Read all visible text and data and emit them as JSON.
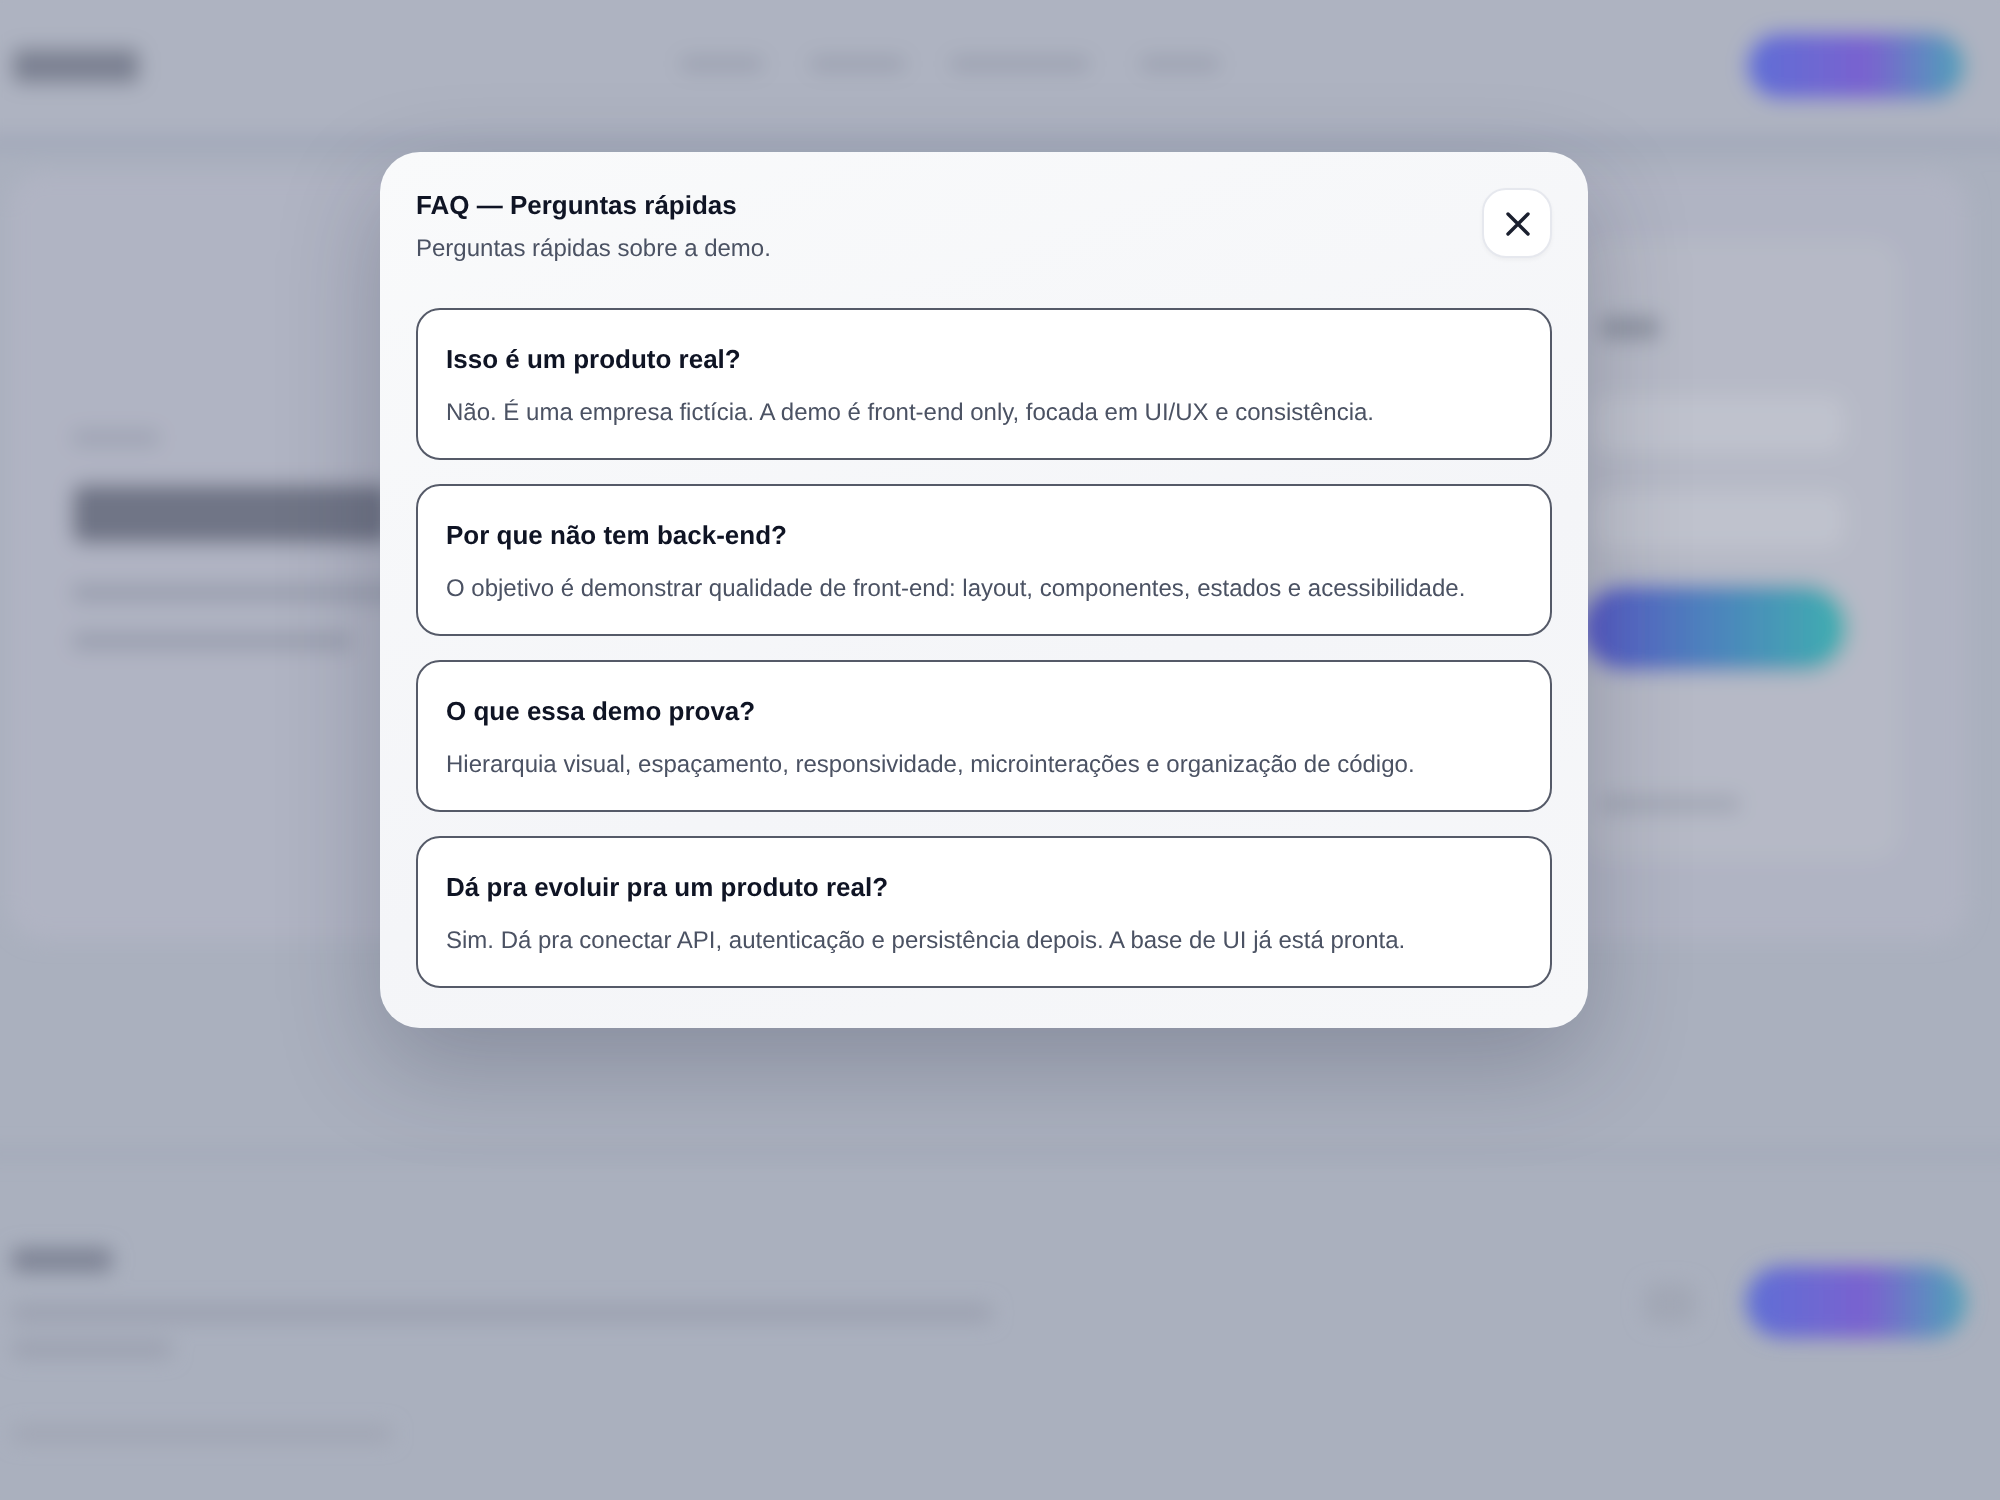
{
  "dialog": {
    "title": "FAQ — Perguntas rápidas",
    "subtitle": "Perguntas rápidas sobre a demo.",
    "items": [
      {
        "question": "Isso é um produto real?",
        "answer": "Não. É uma empresa fictícia. A demo é front-end only, focada em UI/UX e consistência."
      },
      {
        "question": "Por que não tem back-end?",
        "answer": "O objetivo é demonstrar qualidade de front-end: layout, componentes, estados e acessibilidade."
      },
      {
        "question": "O que essa demo prova?",
        "answer": "Hierarquia visual, espaçamento, responsividade, microinterações e organização de código."
      },
      {
        "question": "Dá pra evoluir pra um produto real?",
        "answer": "Sim. Dá pra conectar API, autenticação e persistência depois. A base de UI já está pronta."
      }
    ]
  }
}
